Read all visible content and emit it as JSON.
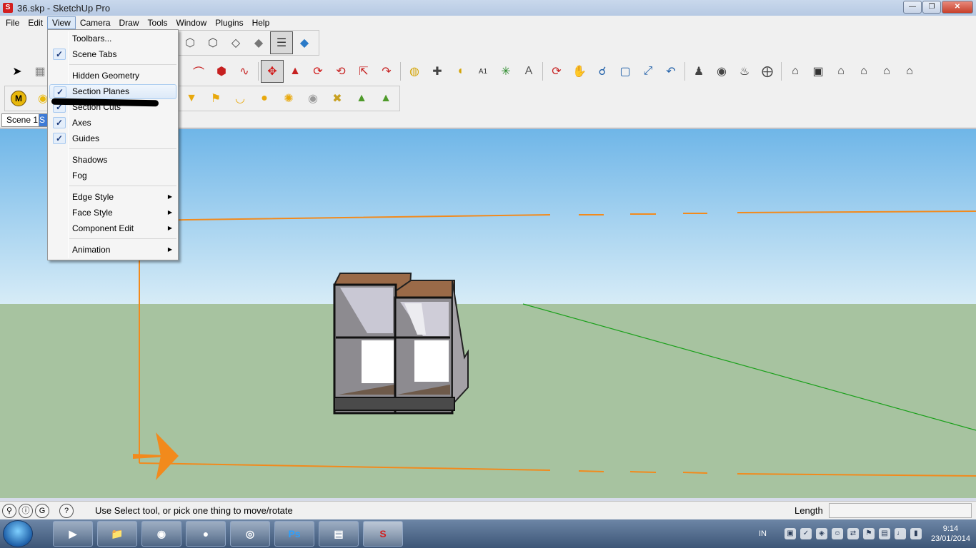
{
  "window": {
    "title": "36.skp - SketchUp Pro",
    "controls": [
      "minimize",
      "maximize",
      "close"
    ]
  },
  "menubar": [
    "File",
    "Edit",
    "View",
    "Camera",
    "Draw",
    "Tools",
    "Window",
    "Plugins",
    "Help"
  ],
  "view_menu": {
    "items": [
      {
        "label": "Toolbars...",
        "checked": false
      },
      {
        "label": "Scene Tabs",
        "checked": true
      },
      {
        "label": "Hidden Geometry",
        "checked": false
      },
      {
        "label": "Section Planes",
        "checked": true,
        "highlighted": true
      },
      {
        "label": "Section Cuts",
        "checked": true
      },
      {
        "label": "Axes",
        "checked": true
      },
      {
        "label": "Guides",
        "checked": true
      },
      {
        "label": "Shadows",
        "checked": false
      },
      {
        "label": "Fog",
        "checked": false
      },
      {
        "label": "Edge Style",
        "submenu": true
      },
      {
        "label": "Face Style",
        "submenu": true
      },
      {
        "label": "Component Edit",
        "submenu": true
      },
      {
        "label": "Animation",
        "submenu": true
      }
    ]
  },
  "scene_tabs": [
    "Scene 1",
    "S"
  ],
  "statusbar": {
    "message": "Use Select tool, or pick one thing to move/rotate",
    "vcb_label": "Length",
    "vcb_value": ""
  },
  "taskbar": {
    "apps": [
      "media-player",
      "file-explorer",
      "firefox",
      "messenger",
      "chrome",
      "photoshop",
      "control-panel",
      "sketchup"
    ],
    "photoshop_label": "Ps",
    "language": "IN",
    "time": "9:14",
    "date": "23/01/2014"
  },
  "colors": {
    "sky": "#bfe0f5",
    "ground": "#a7c3a0",
    "section_plane": "#f28a1c",
    "green_axis": "#1a9e1a"
  }
}
